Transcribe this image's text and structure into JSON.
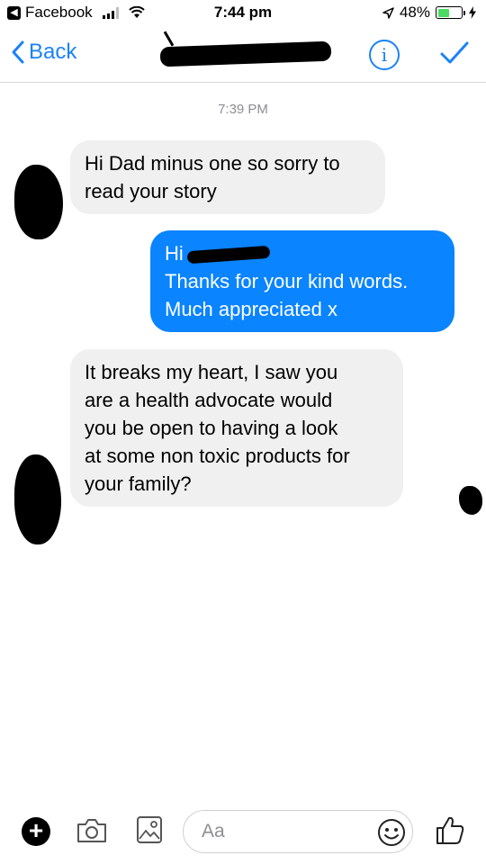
{
  "status_bar": {
    "back_app": "Facebook",
    "time": "7:44 pm",
    "battery": "48%",
    "battery_level": 0.48
  },
  "nav": {
    "back_label": "Back",
    "info_glyph": "i",
    "accent_color": "#1a82f7"
  },
  "conversation": {
    "timestamp": "7:39 PM",
    "messages": [
      {
        "direction": "incoming",
        "lines": [
          "Hi Dad minus one so sorry to",
          "read your story"
        ]
      },
      {
        "direction": "outgoing",
        "greeting": "Hi",
        "lines": [
          "Thanks for your kind words.",
          "Much appreciated x"
        ]
      },
      {
        "direction": "incoming",
        "lines": [
          "It breaks my heart, I saw you",
          "are a health advocate would",
          "you be open to having a look",
          "at some non toxic products for",
          "your family?"
        ]
      }
    ],
    "incoming_bubble_color": "#f0f0f0",
    "outgoing_bubble_color": "#0a84ff"
  },
  "composer": {
    "placeholder": "Aa",
    "plus_glyph": "+"
  },
  "icons": [
    "back-chevron-icon",
    "info-icon",
    "checkmark-icon",
    "plus-icon",
    "camera-icon",
    "photo-icon",
    "emoji-icon",
    "thumbs-up-icon"
  ]
}
